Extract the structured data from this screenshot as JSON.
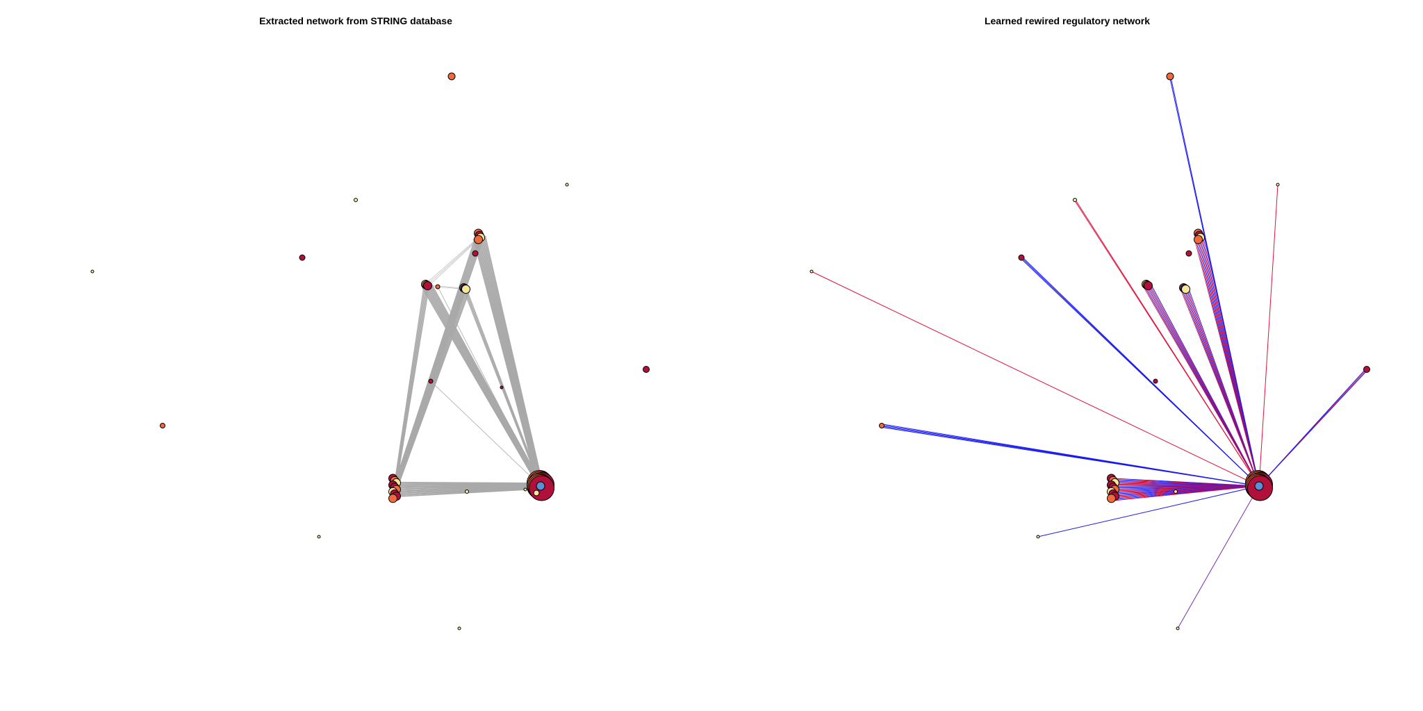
{
  "panels": [
    {
      "title": "Extracted network from STRING database"
    },
    {
      "title": "Learned rewired regulatory network"
    }
  ],
  "colors": {
    "string_edge": "#a9a9a9",
    "regulatory_blue": "#1a1aee",
    "regulatory_red": "#e0103a",
    "node_dark_red": "#b0103a",
    "node_orange": "#f06a3c",
    "node_light": "#f6e79a",
    "node_blue": "#5b8fd6",
    "outline": "#000000"
  }
}
